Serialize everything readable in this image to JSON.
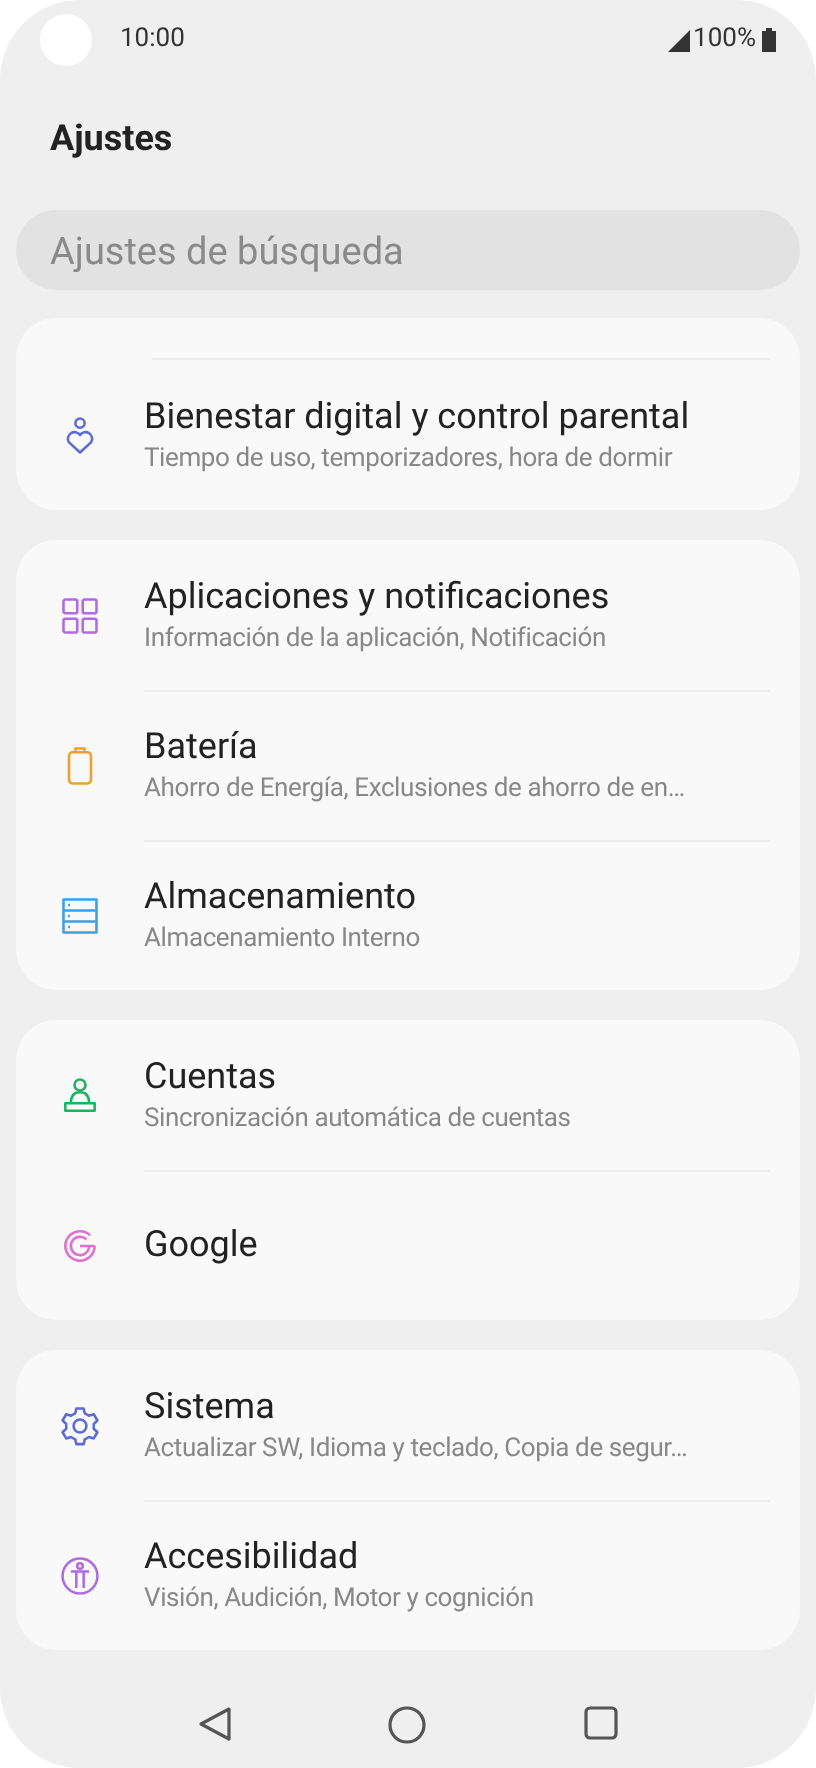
{
  "status_bar": {
    "time": "10:00",
    "battery": "100%"
  },
  "title": "Ajustes",
  "search": {
    "placeholder": "Ajustes de búsqueda"
  },
  "groups": [
    {
      "top_divider": true,
      "items": [
        {
          "kind": "wellbeing",
          "color": "#5c6bd6",
          "title": "Bienestar digital y control parental",
          "subtitle": "Tiempo de uso, temporizadores, hora de dormir"
        }
      ]
    },
    {
      "top_divider": false,
      "items": [
        {
          "kind": "apps",
          "color": "#b06be0",
          "title": "Aplicaciones y notificaciones",
          "subtitle": "Información de la aplicación, Notificación"
        },
        {
          "kind": "battery",
          "color": "#f0a030",
          "title": "Batería",
          "subtitle": "Ahorro de Energía, Exclusiones de ahorro de en…"
        },
        {
          "kind": "storage",
          "color": "#3aa0e8",
          "title": "Almacenamiento",
          "subtitle": "Almacenamiento Interno"
        }
      ]
    },
    {
      "top_divider": false,
      "items": [
        {
          "kind": "accounts",
          "color": "#22b060",
          "title": "Cuentas",
          "subtitle": "Sincronización automática de cuentas"
        },
        {
          "kind": "google",
          "color": "#e070d0",
          "title": "Google"
        }
      ]
    },
    {
      "top_divider": false,
      "items": [
        {
          "kind": "system",
          "color": "#5c6bd6",
          "title": "Sistema",
          "subtitle": "Actualizar SW, Idioma y teclado, Copia de segur…"
        },
        {
          "kind": "accessibility",
          "color": "#b06be0",
          "title": "Accesibilidad",
          "subtitle": "Visión, Audición, Motor y cognición"
        }
      ]
    }
  ]
}
